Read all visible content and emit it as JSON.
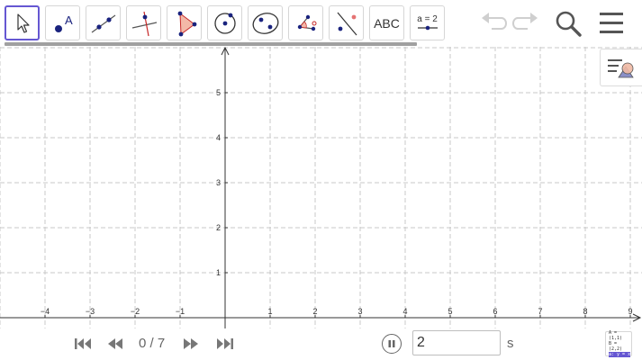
{
  "toolbar": {
    "text_tool_label": "ABC",
    "slider_tool_label": "a = 2",
    "tools": [
      "move",
      "point",
      "line",
      "perpendicular-line",
      "polygon",
      "circle-center-point",
      "conic-five-points",
      "angle",
      "reflect-about-line",
      "text",
      "slider"
    ]
  },
  "animation": {
    "step_counter": "0 / 7",
    "speed_value": "2",
    "speed_unit": "s"
  },
  "algebra_button": {
    "line1": "A = (1,1)",
    "line2": "B = (2,2)",
    "line3": "a: y = x"
  },
  "axes": {
    "x_ticks": [
      "−4",
      "−3",
      "−2",
      "−1",
      "1",
      "2",
      "3",
      "4",
      "5",
      "6",
      "7",
      "8",
      "9"
    ],
    "y_ticks": [
      "1",
      "2",
      "3",
      "4",
      "5"
    ]
  },
  "colors": {
    "accent": "#6557d2",
    "point": "#1565c0",
    "grid": "#c8c8c8",
    "polygon_fill": "#f3b8a8"
  }
}
